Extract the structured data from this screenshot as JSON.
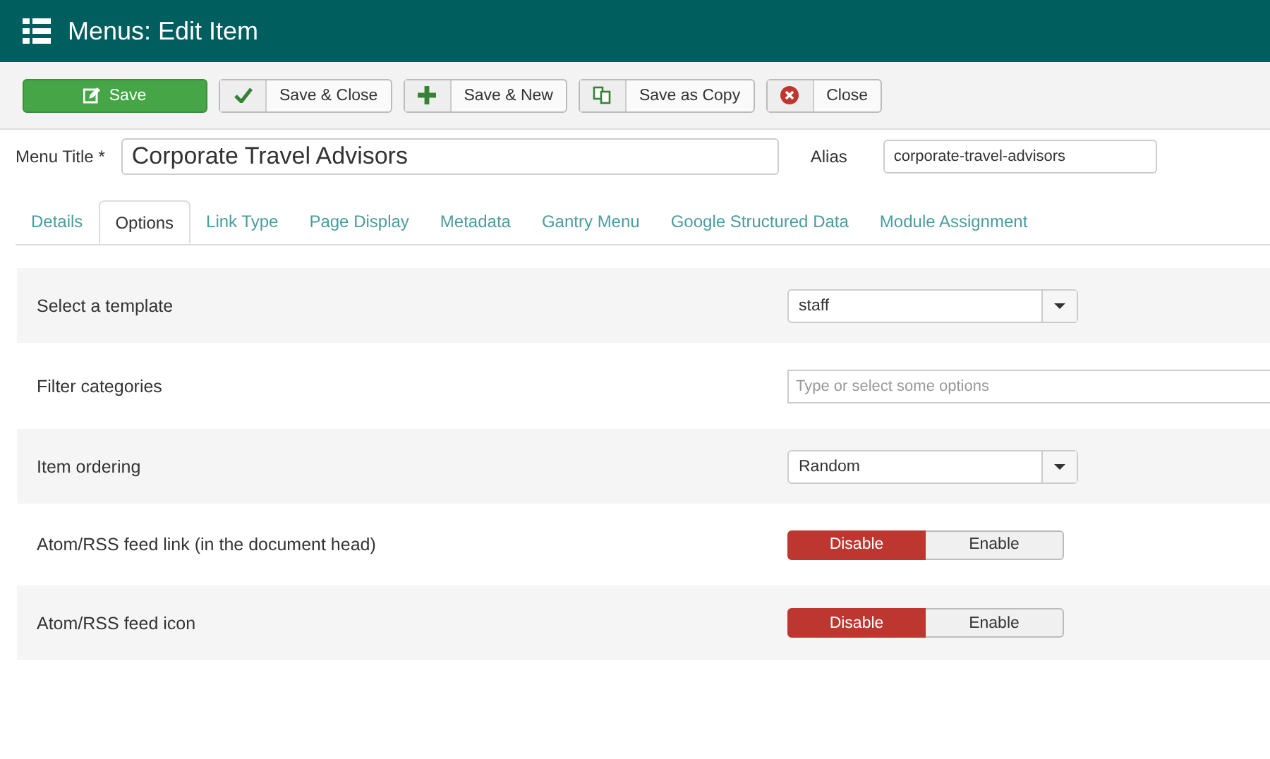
{
  "header": {
    "title": "Menus: Edit Item"
  },
  "toolbar": [
    {
      "kind": "save",
      "label": "Save"
    },
    {
      "kind": "check",
      "label": "Save & Close"
    },
    {
      "kind": "plus",
      "label": "Save & New"
    },
    {
      "kind": "copy",
      "label": "Save as Copy"
    },
    {
      "kind": "close",
      "label": "Close"
    }
  ],
  "menu_title": {
    "label": "Menu Title *",
    "value": "Corporate Travel Advisors"
  },
  "alias": {
    "label": "Alias",
    "value": "corporate-travel-advisors"
  },
  "tabs": [
    {
      "label": "Details",
      "selected": false
    },
    {
      "label": "Options",
      "selected": true
    },
    {
      "label": "Link Type",
      "selected": false
    },
    {
      "label": "Page Display",
      "selected": false
    },
    {
      "label": "Metadata",
      "selected": false
    },
    {
      "label": "Gantry Menu",
      "selected": false
    },
    {
      "label": "Google Structured Data",
      "selected": false
    },
    {
      "label": "Module Assignment",
      "selected": false
    }
  ],
  "fields": [
    {
      "kind": "select",
      "label": "Select a template",
      "value": "staff"
    },
    {
      "kind": "multiselect",
      "label": "Filter categories",
      "placeholder": "Type or select some options"
    },
    {
      "kind": "select",
      "label": "Item ordering",
      "value": "Random"
    },
    {
      "kind": "toggle",
      "label": "Atom/RSS feed link (in the document head)",
      "options": [
        {
          "label": "Disable",
          "selected": true
        },
        {
          "label": "Enable",
          "selected": false
        }
      ]
    },
    {
      "kind": "toggle",
      "label": "Atom/RSS feed icon",
      "options": [
        {
          "label": "Disable",
          "selected": true
        },
        {
          "label": "Enable",
          "selected": false
        }
      ]
    }
  ]
}
